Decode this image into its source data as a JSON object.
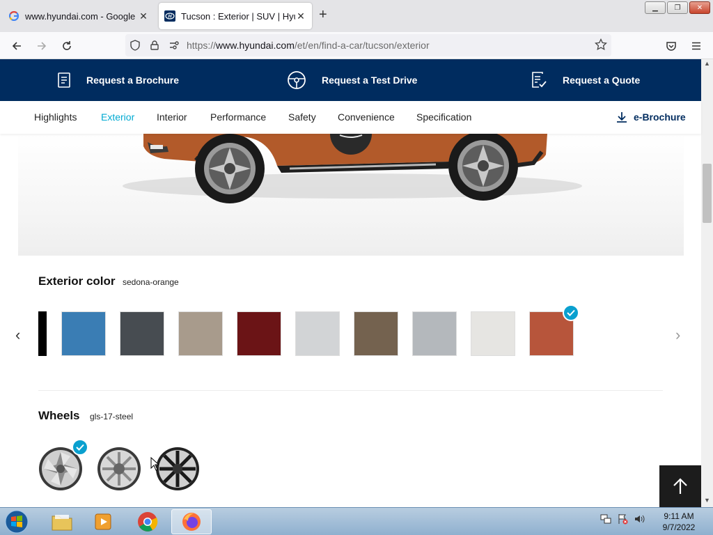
{
  "browser": {
    "tabs": [
      {
        "title": "www.hyundai.com - Google Sea",
        "active": false
      },
      {
        "title": "Tucson : Exterior | SUV | Hyunda",
        "active": true
      }
    ],
    "url_prefix": "https://",
    "url_domain": "www.hyundai.com",
    "url_path": "/et/en/find-a-car/tucson/exterior"
  },
  "cta": {
    "brochure": "Request a Brochure",
    "test_drive": "Request a Test Drive",
    "quote": "Request a Quote"
  },
  "subnav": {
    "items": [
      "Highlights",
      "Exterior",
      "Interior",
      "Performance",
      "Safety",
      "Convenience",
      "Specification"
    ],
    "active": "Exterior",
    "ebrochure": "e-Brochure"
  },
  "exterior": {
    "title": "Exterior color",
    "selected": "sedona-orange",
    "swatches": [
      "#000000",
      "#3a7db4",
      "#474c51",
      "#a89b8c",
      "#6b1416",
      "#d2d4d6",
      "#74624f",
      "#b4b8bc",
      "#e6e5e2",
      "#b7553b"
    ]
  },
  "wheels": {
    "title": "Wheels",
    "selected": "gls-17-steel"
  },
  "taskbar": {
    "time": "9:11 AM",
    "date": "9/7/2022"
  },
  "colors": {
    "brand_navy": "#002c5f",
    "accent": "#00aad2",
    "check": "#0aa0cf"
  }
}
